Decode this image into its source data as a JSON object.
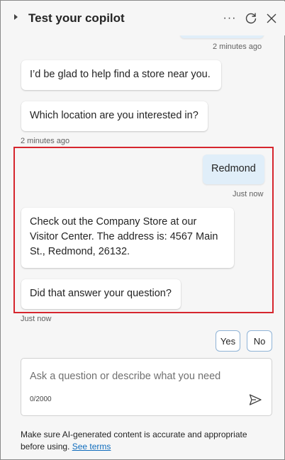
{
  "header": {
    "title": "Test your copilot",
    "more_label": "···"
  },
  "messages": {
    "top_timestamp": "2 minutes ago",
    "bot_1": "I’d be glad to help find a store near you.",
    "bot_2": "Which location are you interested in?",
    "bot_group_timestamp": "2 minutes ago",
    "user_1": "Redmond",
    "user_timestamp": "Just now",
    "bot_3": "Check out the Company Store at our Visitor Center. The address is: 4567 Main St., Redmond, 26132.",
    "bot_4": "Did that answer your question?",
    "bot_last_timestamp": "Just now"
  },
  "quick_replies": {
    "yes": "Yes",
    "no": "No"
  },
  "composer": {
    "placeholder": "Ask a question or describe what you need",
    "value": "",
    "counter": "0/2000"
  },
  "disclaimer": {
    "text": "Make sure AI-generated content is accurate and appropriate before using. ",
    "link": "See terms"
  },
  "colors": {
    "highlight_border": "#d6262e",
    "user_bubble": "#e0eef9",
    "link": "#0f6cbd"
  }
}
